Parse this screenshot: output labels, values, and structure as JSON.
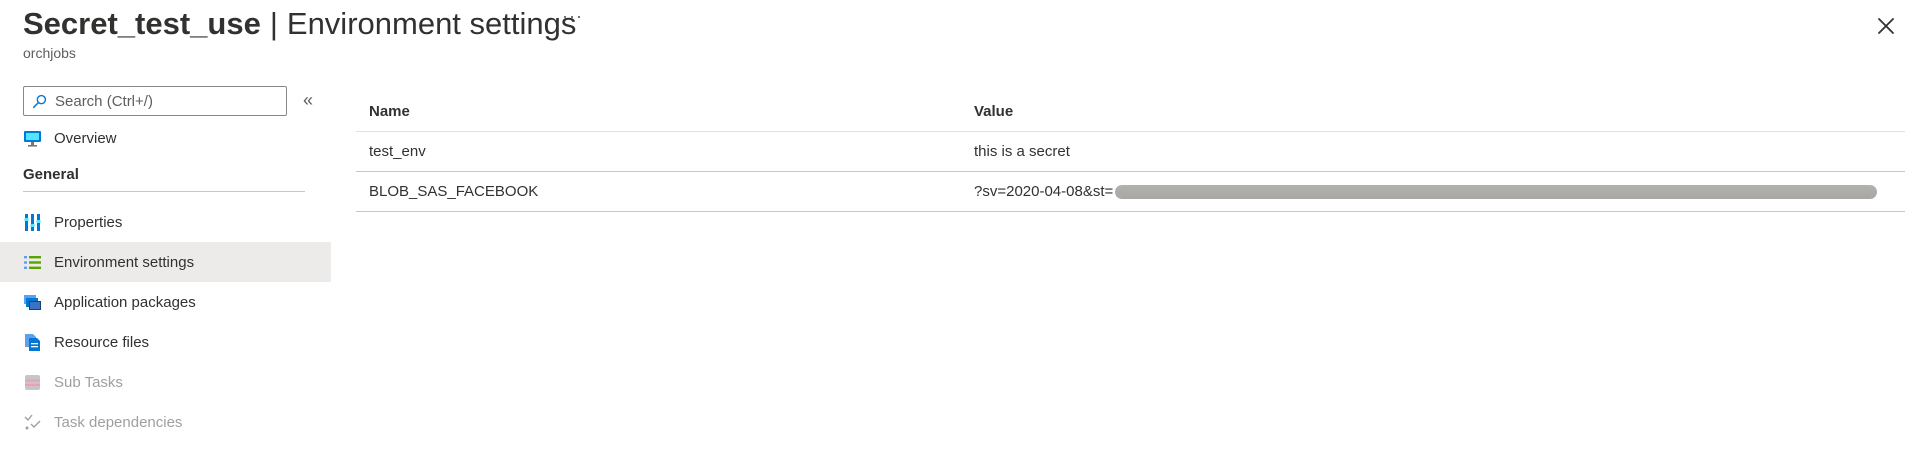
{
  "header": {
    "title_bold": "Secret_test_use",
    "separator": "|",
    "title_light": "Environment settings",
    "more_label": "···",
    "subtitle": "orchjobs"
  },
  "sidebar": {
    "search_placeholder": "Search (Ctrl+/)",
    "collapse_label": "«",
    "items_top": [
      {
        "label": "Overview",
        "icon": "monitor-icon"
      }
    ],
    "section_label": "General",
    "items": [
      {
        "label": "Properties",
        "icon": "properties-icon"
      },
      {
        "label": "Environment settings",
        "icon": "list-icon",
        "selected": true
      },
      {
        "label": "Application packages",
        "icon": "packages-icon"
      },
      {
        "label": "Resource files",
        "icon": "files-icon"
      },
      {
        "label": "Sub Tasks",
        "icon": "subtasks-icon",
        "disabled": true
      },
      {
        "label": "Task dependencies",
        "icon": "dependencies-icon",
        "disabled": true
      }
    ]
  },
  "table": {
    "headers": [
      "Name",
      "Value"
    ],
    "rows": [
      {
        "name": "test_env",
        "value": "this is a secret"
      },
      {
        "name": "BLOB_SAS_FACEBOOK",
        "value": "?sv=2020-04-08&st="
      }
    ]
  },
  "colors": {
    "accent_blue": "#0078d4",
    "selected_bg": "#edebe9",
    "disabled_text": "#a19f9d"
  }
}
